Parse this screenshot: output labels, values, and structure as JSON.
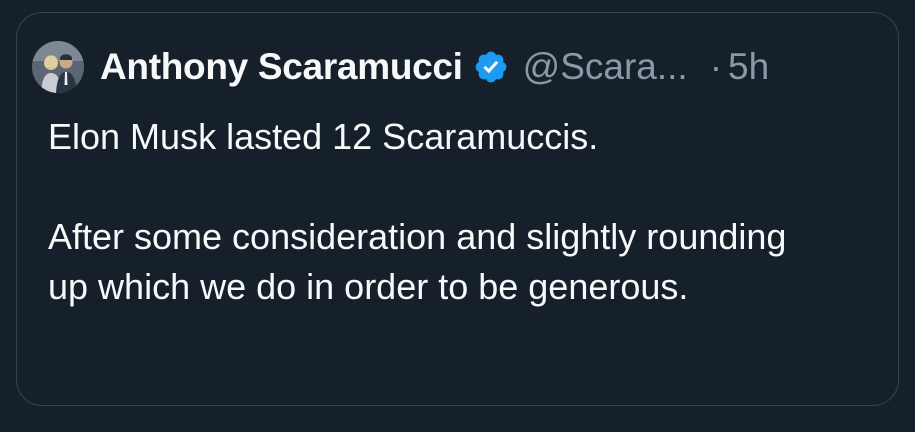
{
  "tweet": {
    "author": {
      "display_name": "Anthony Scaramucci",
      "handle": "@Scara...",
      "avatar_icon": "avatar-photo-icon",
      "verified_icon": "verified-badge-icon",
      "verified_color": "#1d9bf0"
    },
    "separator": "·",
    "timestamp": "5h",
    "paragraphs": [
      "Elon Musk lasted 12 Scaramuccis.",
      "After some consideration and slightly rounding up which we do in order to be generous."
    ]
  },
  "colors": {
    "background": "#15202b",
    "border": "#38444d",
    "primary_text": "#f7f9f9",
    "secondary_text": "#8b98a5"
  }
}
